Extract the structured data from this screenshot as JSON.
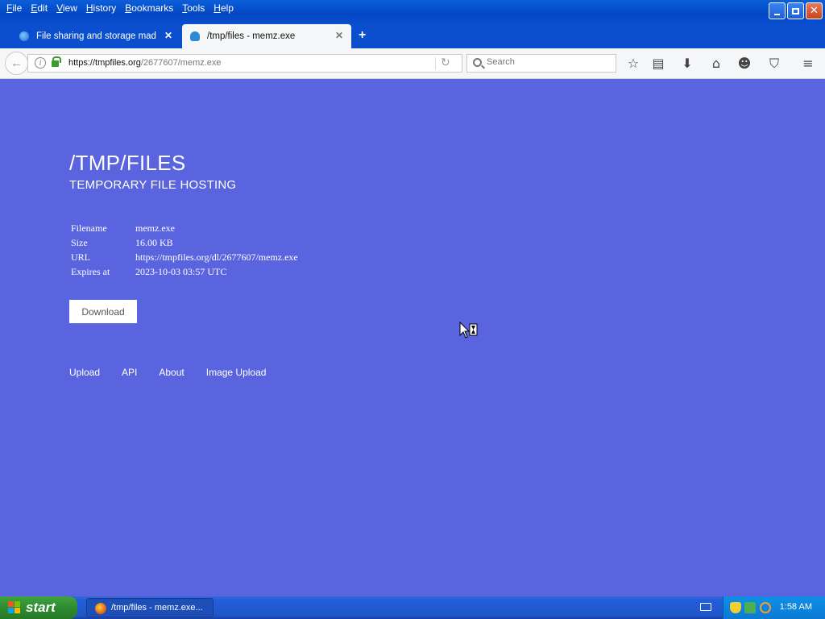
{
  "menubar": {
    "items": [
      "File",
      "Edit",
      "View",
      "History",
      "Bookmarks",
      "Tools",
      "Help"
    ]
  },
  "tabs": [
    {
      "title": "File sharing and storage mad...",
      "active": false
    },
    {
      "title": "/tmp/files - memz.exe",
      "active": true
    }
  ],
  "navbar": {
    "url_host": "https://tmpfiles.org",
    "url_path": "/2677607/memz.exe",
    "search_placeholder": "Search"
  },
  "page": {
    "title": "/TMP/FILES",
    "subtitle": "TEMPORARY FILE HOSTING",
    "file_info": [
      {
        "label": "Filename",
        "value": "memz.exe"
      },
      {
        "label": "Size",
        "value": "16.00 KB"
      },
      {
        "label": "URL",
        "value": "https://tmpfiles.org/dl/2677607/memz.exe"
      },
      {
        "label": "Expires at",
        "value": "2023-10-03 03:57 UTC"
      }
    ],
    "download_label": "Download",
    "footer_links": [
      "Upload",
      "API",
      "About",
      "Image Upload"
    ]
  },
  "taskbar": {
    "start_label": "start",
    "task_title": "/tmp/files - memz.exe...",
    "clock": "1:58 AM"
  },
  "colors": {
    "page_background": "#5a64df",
    "xp_blue": "#0b4fcf",
    "start_green": "#2f8c2f"
  }
}
